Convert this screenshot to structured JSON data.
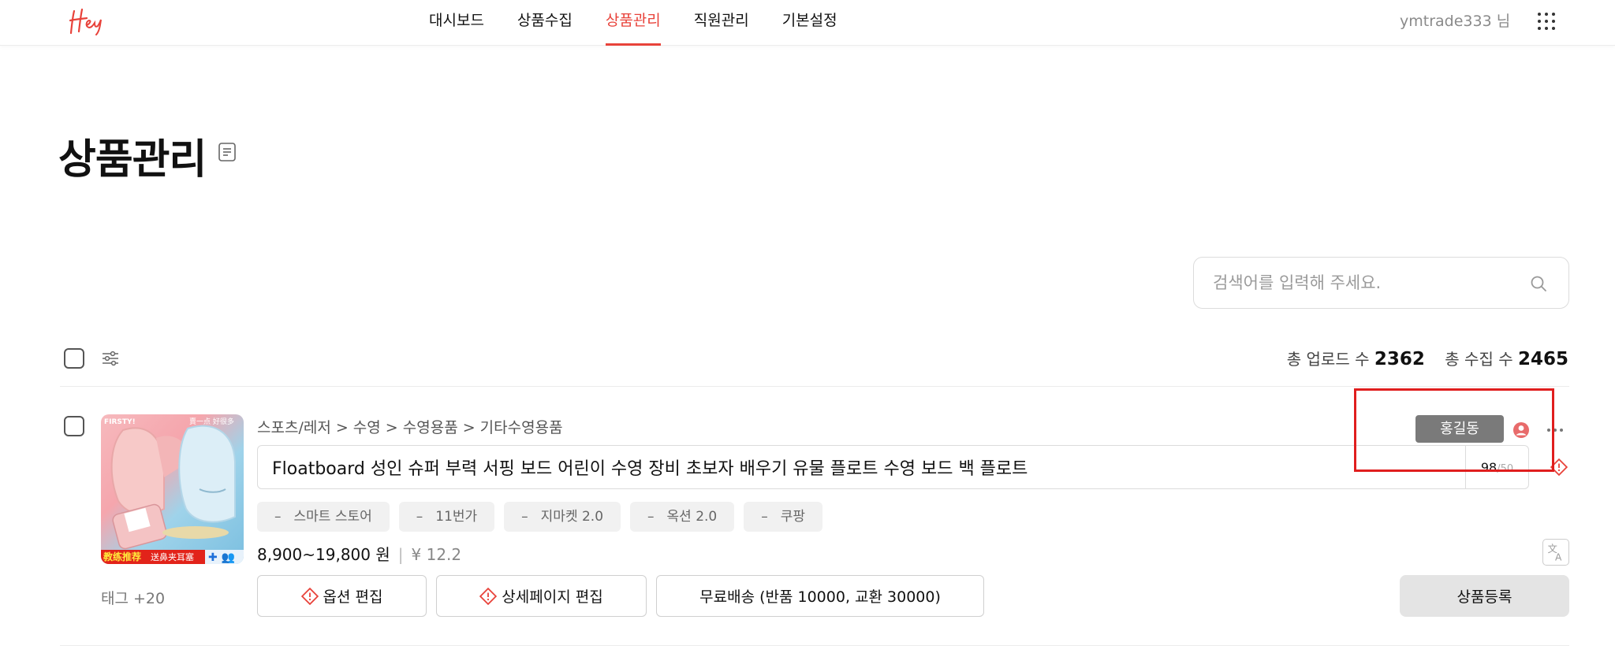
{
  "header": {
    "logo_text": "Hey",
    "nav": [
      {
        "label": "대시보드",
        "active": false
      },
      {
        "label": "상품수집",
        "active": false
      },
      {
        "label": "상품관리",
        "active": true
      },
      {
        "label": "직원관리",
        "active": false
      },
      {
        "label": "기본설정",
        "active": false
      }
    ],
    "user_label": "ymtrade333 님",
    "apps_icon": "grid-dots-icon"
  },
  "page": {
    "title": "상품관리"
  },
  "search": {
    "placeholder": "검색어를 입력해 주세요.",
    "value": ""
  },
  "toolbar": {
    "upload_label": "총 업로드 수",
    "upload_count": "2362",
    "collect_label": "총 수집 수",
    "collect_count": "2465"
  },
  "product": {
    "thumbnail": {
      "brand_text": "FIRSTY!",
      "corner_text": "賣一点 好很多",
      "banner_text": "教练推荐",
      "banner_sub": "送鼻夹耳塞"
    },
    "breadcrumb": "스포츠/레저 > 수영 > 수영용품 > 기타수영용품",
    "title": "Floatboard 성인 슈퍼 부력 서핑 보드 어린이 수영 장비 초보자 배우기 유물 플로트 수영 보드 백 플로트",
    "char_count": "98",
    "char_max": "/50",
    "markets": [
      "스마트 스토어",
      "11번가",
      "지마켓 2.0",
      "옥션 2.0",
      "쿠팡"
    ],
    "price": "8,900~19,800 원",
    "price_cny": "¥ 12.2",
    "tags": "태그 +20",
    "assignee": "홍길동",
    "buttons": {
      "option_edit": "옵션 편집",
      "detail_edit": "상세페이지 편집",
      "shipping": "무료배송 (반품 10000, 교환 30000)",
      "register": "상품등록"
    }
  },
  "colors": {
    "accent": "#e8423a",
    "highlight": "#e01e1e",
    "assignee_bg": "#7a7a7a"
  }
}
